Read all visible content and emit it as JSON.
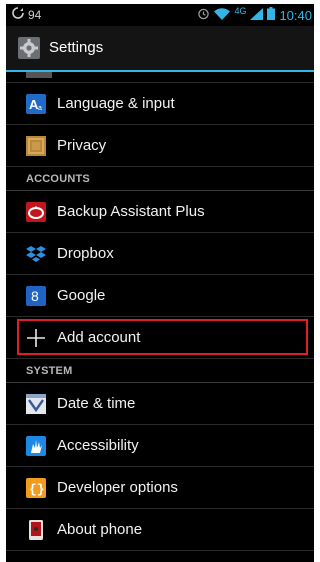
{
  "status_bar": {
    "notification_count": "94",
    "network": "4G",
    "time": "10:40",
    "icons": [
      "sync-icon",
      "alarm-icon",
      "wifi-icon",
      "signal-icon",
      "battery-icon"
    ]
  },
  "action_bar": {
    "title": "Settings",
    "icon": "settings-gear-icon"
  },
  "sections": {
    "personal": [
      {
        "label": "Language & input",
        "icon": "language-icon"
      },
      {
        "label": "Privacy",
        "icon": "privacy-icon"
      }
    ],
    "accounts_header": "ACCOUNTS",
    "accounts": [
      {
        "label": "Backup Assistant Plus",
        "icon": "backup-assistant-icon"
      },
      {
        "label": "Dropbox",
        "icon": "dropbox-icon"
      },
      {
        "label": "Google",
        "icon": "google-icon"
      },
      {
        "label": "Add account",
        "icon": "plus-icon"
      }
    ],
    "system_header": "SYSTEM",
    "system": [
      {
        "label": "Date & time",
        "icon": "date-time-icon"
      },
      {
        "label": "Accessibility",
        "icon": "accessibility-icon"
      },
      {
        "label": "Developer options",
        "icon": "developer-options-icon"
      },
      {
        "label": "About phone",
        "icon": "about-phone-icon"
      }
    ]
  },
  "colors": {
    "accent": "#33b5e5",
    "highlight_box": "#e01e2b",
    "background": "#000000"
  }
}
